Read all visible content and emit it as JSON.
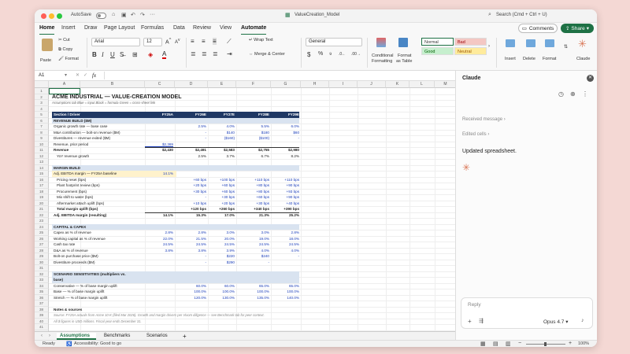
{
  "titlebar": {
    "autosave": "AutoSave",
    "filename": "ValueCreation_Model",
    "search": "Search (Cmd + Ctrl + U)"
  },
  "menu": {
    "items": [
      "Home",
      "Insert",
      "Draw",
      "Page Layout",
      "Formulas",
      "Data",
      "Review",
      "View",
      "Automate"
    ],
    "comments": "Comments",
    "share": "Share"
  },
  "ribbon": {
    "paste": "Paste",
    "cut": "Cut",
    "copy": "Copy",
    "format": "Format",
    "font": "Arial",
    "size": "12",
    "wrap": "Wrap Text",
    "merge": "Merge & Center",
    "numfmt": "General",
    "cond": "Conditional",
    "cond2": "Formatting",
    "fat": "Format",
    "fat2": "as Table",
    "styles": [
      "Normal",
      "Bad",
      "Good",
      "Neutral"
    ],
    "insert": "Insert",
    "delete": "Delete",
    "format2": "Format",
    "claude": "Claude"
  },
  "formula": {
    "cell": "A1",
    "fx": "fx"
  },
  "columns": [
    "A",
    "B",
    "C",
    "D",
    "E",
    "F",
    "G",
    "H",
    "I",
    "J",
    "K",
    "L",
    "M",
    "N",
    "O"
  ],
  "rows": [
    "1",
    "2",
    "3",
    "4",
    "5",
    "6",
    "7",
    "8",
    "9",
    "10",
    "11",
    "12",
    "13",
    "14",
    "15",
    "16",
    "17",
    "18",
    "19",
    "20",
    "21",
    "22",
    "23",
    "24",
    "25",
    "26",
    "27",
    "28",
    "29",
    "30",
    "31",
    "32",
    "33",
    "34",
    "35",
    "36",
    "37",
    "38",
    "39",
    "40",
    "41",
    "42"
  ],
  "sheet": {
    "title": "ACME INDUSTRIAL — VALUE-CREATION MODEL",
    "subtitle": "Assumptions tab   Blue = input   Black = formula   Green = cross-sheet link",
    "header": [
      "Section / Driver",
      "FY25A",
      "FY26E",
      "FY27E",
      "FY28E",
      "FY29E"
    ],
    "sec_revenue": "REVENUE BUILD ($M)",
    "r7": [
      "Organic growth rate — base case",
      "",
      "2.5%",
      "4.0%",
      "5.5%",
      "6.0%"
    ],
    "r8": [
      "M&A contribution — bolt-on revenue ($M)",
      "",
      "-",
      "$140",
      "$180",
      "$60"
    ],
    "r9": [
      "Divestitures — revenue exited ($M)",
      "",
      "-",
      "($160)",
      "($100)",
      "-"
    ],
    "r10": [
      "Revenue, prior period",
      "$2,369",
      "",
      "",
      "",
      ""
    ],
    "r11": [
      "Revenue",
      "$2,430",
      "$2,491",
      "$2,583",
      "$2,755",
      "$2,980"
    ],
    "r12": [
      "YoY revenue growth",
      "",
      "2.5%",
      "3.7%",
      "6.7%",
      "8.2%"
    ],
    "sec_margin": "MARGIN BUILD",
    "r15": [
      "Adj. EBITDA margin — FY25A baseline",
      "14.1%"
    ],
    "r16": [
      "Pricing reset (bps)",
      "",
      "+60 bps",
      "+100 bps",
      "+110 bps",
      "+110 bps"
    ],
    "r17": [
      "Plant footprint review (bps)",
      "",
      "+20 bps",
      "+60 bps",
      "+80 bps",
      "+90 bps"
    ],
    "r18": [
      "Procurement (bps)",
      "",
      "+30 bps",
      "+60 bps",
      "+80 bps",
      "+93 bps"
    ],
    "r19": [
      "Mix shift to water (bps)",
      "",
      "-",
      "+30 bps",
      "+60 bps",
      "+90 bps"
    ],
    "r20": [
      "Aftermarket attach uplift (bps)",
      "",
      "+10 bps",
      "+20 bps",
      "+30 bps",
      "+40 bps"
    ],
    "r21": [
      "Total margin uplift (bps)",
      "",
      "+120 bps",
      "+260 bps",
      "+340 bps",
      "+390 bps"
    ],
    "r22": [
      "Adj. EBITDA margin (resulting)",
      "14.1%",
      "15.3%",
      "17.0%",
      "21.3%",
      "25.2%"
    ],
    "sec_capital": "CAPITAL & CAPEX",
    "r25": [
      "Capex as % of revenue",
      "2.8%",
      "2.8%",
      "3.0%",
      "3.0%",
      "2.8%"
    ],
    "r26": [
      "Working capital as % of revenue",
      "22.0%",
      "21.5%",
      "20.0%",
      "19.0%",
      "18.0%"
    ],
    "r27": [
      "Cash tax rate",
      "24.5%",
      "24.5%",
      "24.5%",
      "24.5%",
      "24.5%"
    ],
    "r28": [
      "D&A as % of revenue",
      "3.8%",
      "3.8%",
      "3.9%",
      "4.0%",
      "4.0%"
    ],
    "r29": [
      "Bolt-on purchase price ($M)",
      "",
      "-",
      "$220",
      "$240",
      "-"
    ],
    "r30": [
      "Divestiture proceeds ($M)",
      "",
      "-",
      "$290",
      "-",
      ""
    ],
    "sec_scenario": "SCENARIO SENSITIVITIES (multipliers vs.",
    "sec_scenario2": "base)",
    "r34": [
      "Conservative — % of base margin uplift",
      "",
      "60.0%",
      "60.0%",
      "65.0%",
      "65.0%"
    ],
    "r35": [
      "Base — % of base margin uplift",
      "",
      "100.0%",
      "100.0%",
      "100.0%",
      "100.0%"
    ],
    "r36": [
      "Stretch — % of base margin uplift",
      "",
      "120.0%",
      "130.0%",
      "135.0%",
      "140.0%"
    ],
    "notes_title": "Notes & sources",
    "note1": "Source: FY25A actuals from Acme 10-K (filed Mar 2026). Growth and margin drivers per Vixom diligence — see Benchmark tab for peer context.",
    "note2": "All $ figures in USD millions. Fiscal year ends December 31."
  },
  "tabs": [
    "Assumptions",
    "Benchmarks",
    "Scenarios",
    "+"
  ],
  "status": {
    "ready": "Ready",
    "accessibility": "Accessibility: Good to go",
    "zoom": "100%"
  },
  "panel": {
    "title": "Claude",
    "received": "Received message",
    "edited": "Edited cells",
    "message": "Updated spreadsheet.",
    "reply": "Reply",
    "model": "Opus 4.7"
  },
  "colors": {
    "accent": "#1e7145",
    "header": "#1f3864",
    "section": "#d9e3f0",
    "input": "#1a3db8",
    "claude": "#d97757"
  }
}
